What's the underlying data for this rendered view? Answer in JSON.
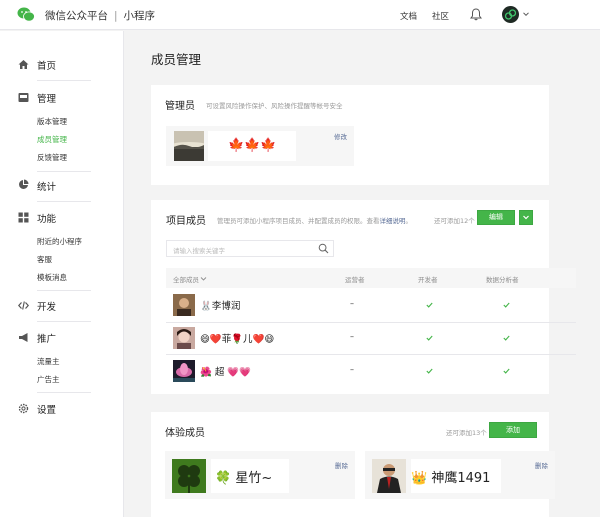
{
  "topbar": {
    "brand": "微信公众平台",
    "separator": "|",
    "product": "小程序",
    "docs": "文档",
    "community": "社区"
  },
  "sidebar": {
    "home": "首页",
    "manage": "管理",
    "manage_items": [
      "版本管理",
      "成员管理",
      "反馈管理"
    ],
    "stats": "统计",
    "features": "功能",
    "feature_items": [
      "附近的小程序",
      "客服",
      "模板消息"
    ],
    "develop": "开发",
    "promote": "推广",
    "promote_items": [
      "流量主",
      "广告主"
    ],
    "settings": "设置"
  },
  "page": {
    "title": "成员管理"
  },
  "admin": {
    "title": "管理员",
    "desc": "可设置风险操作保护、风险操作提醒等帐号安全",
    "name": "🍁🍁🍁",
    "edit": "修改"
  },
  "project": {
    "title": "项目成员",
    "desc": "管理员可添加小程序项目成员、并配置成员的权限。查看",
    "desc_link": "详细说明",
    "desc_end": "。",
    "quota": "还可添加12个",
    "edit_button": "编辑",
    "search_placeholder": "请输入搜索关键字",
    "columns": [
      "全部成员",
      "运营者",
      "开发者",
      "数据分析者"
    ],
    "members": [
      {
        "name": "🐰李博润",
        "operator": "–",
        "developer": "✔",
        "analyst": "✔"
      },
      {
        "name": "😄❤️菲🌹儿❤️😄",
        "operator": "–",
        "developer": "✔",
        "analyst": "✔"
      },
      {
        "name": "🌺 超 💗💗",
        "operator": "–",
        "developer": "✔",
        "analyst": "✔"
      }
    ]
  },
  "experience": {
    "title": "体验成员",
    "quota": "还可添加13个",
    "add_button": "添加",
    "members": [
      {
        "name": "🍀 星竹~",
        "remove": "删除"
      },
      {
        "name": "👑 神鹰1491",
        "remove": "删除"
      }
    ]
  },
  "colors": {
    "accent": "#44b549",
    "link": "#576b95",
    "muted": "#999999"
  }
}
